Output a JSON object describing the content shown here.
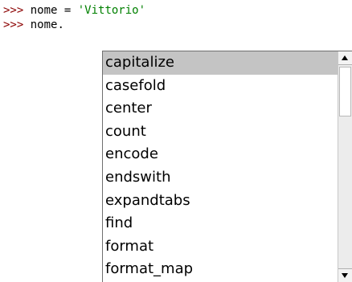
{
  "shell": {
    "prompt": ">>>",
    "line1_code": " nome = ",
    "line1_string": "'Vittorio'",
    "line2_code": " nome."
  },
  "completion": {
    "selected_index": 0,
    "items": [
      {
        "label": "capitalize"
      },
      {
        "label": "casefold"
      },
      {
        "label": "center"
      },
      {
        "label": "count"
      },
      {
        "label": "encode"
      },
      {
        "label": "endswith"
      },
      {
        "label": "expandtabs"
      },
      {
        "label": "find"
      },
      {
        "label": "format"
      },
      {
        "label": "format_map"
      }
    ]
  },
  "colors": {
    "prompt": "#8b0000",
    "string_literal": "#008000",
    "selection": "#c4c4c4"
  },
  "icons": {
    "scroll_up": "scroll-up-arrow-icon",
    "scroll_down": "scroll-down-arrow-icon"
  }
}
